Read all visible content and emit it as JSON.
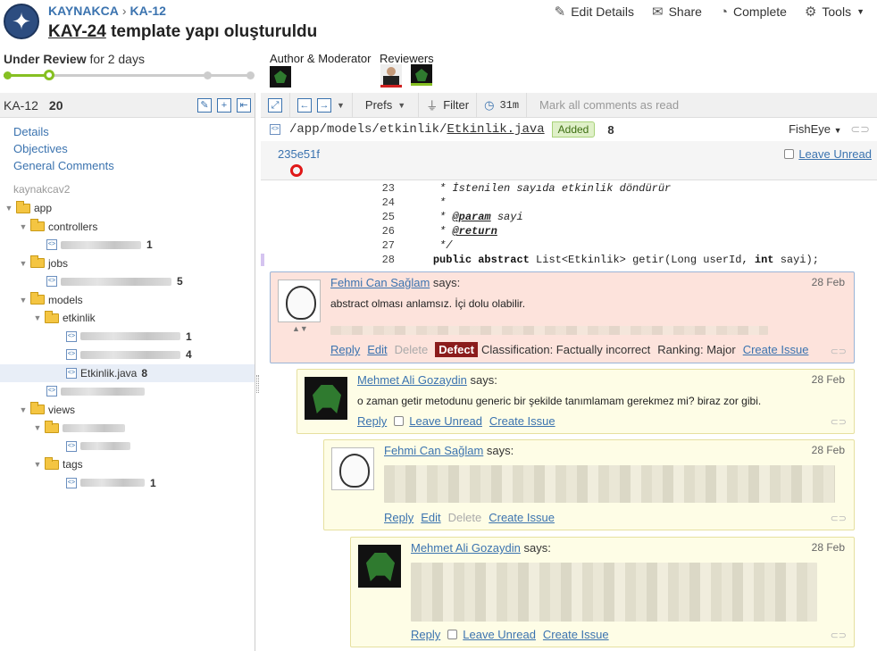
{
  "header": {
    "project": "KAYNAKCA",
    "breadcrumb_sep": "›",
    "review_id": "KA-12",
    "review_key": "KAY-24",
    "review_title": "template yapı oluşturuldu",
    "actions": [
      {
        "label": "Edit Details",
        "icon": "pencil-icon"
      },
      {
        "label": "Share",
        "icon": "envelope-icon"
      },
      {
        "label": "Complete",
        "icon": "check-circle-icon"
      },
      {
        "label": "Tools",
        "icon": "gear-icon"
      }
    ],
    "status_state": "Under Review",
    "status_duration": "for 2 days",
    "progress": 0.19,
    "roles": {
      "author_label": "Author & Moderator",
      "reviewers_label": "Reviewers"
    }
  },
  "left": {
    "review_id": "KA-12",
    "count": "20",
    "links": [
      "Details",
      "Objectives",
      "General Comments"
    ],
    "repo": "kaynakcav2",
    "tree": {
      "app": "app",
      "controllers": "controllers",
      "controllers_file_count": "1",
      "jobs": "jobs",
      "jobs_file_count": "5",
      "models": "models",
      "etkinlik": "etkinlik",
      "etkinlik_f1_count": "1",
      "etkinlik_f2_count": "4",
      "selected_file": "Etkinlik.java",
      "selected_file_count": "8",
      "views": "views",
      "tags": "tags",
      "tags_file_count": "1"
    }
  },
  "right": {
    "toolbar": {
      "prefs": "Prefs",
      "filter": "Filter",
      "timer": "31m",
      "mark_all": "Mark all comments as read"
    },
    "file": {
      "dir": "/app/models/etkinlik/",
      "name": "Etkinlik.java",
      "status": "Added",
      "comment_count": "8",
      "viewer": "FishEye",
      "revision": "235e51f",
      "leave_unread": "Leave Unread"
    },
    "code": [
      {
        "n": "23",
        "t": "     * İstenilen sayıda etkinlik döndürür"
      },
      {
        "n": "24",
        "t": "     *"
      },
      {
        "n": "25",
        "t": "     * @param sayi"
      },
      {
        "n": "26",
        "t": "     * @return"
      },
      {
        "n": "27",
        "t": "     */"
      },
      {
        "n": "28",
        "t": "    public abstract List<Etkinlik> getir(Long userId, int sayi);"
      }
    ],
    "comments": [
      {
        "author": "Fehmi Can Sağlam",
        "says": "says:",
        "date": "28 Feb",
        "text": "abstract olması anlamsız. İçi dolu olabilir.",
        "reply": "Reply",
        "edit": "Edit",
        "delete": "Delete",
        "defect": "Defect",
        "classification": "Classification: Factually incorrect",
        "ranking": "Ranking: Major",
        "create_issue": "Create Issue"
      },
      {
        "author": "Mehmet Ali Gozaydin",
        "says": "says:",
        "date": "28 Feb",
        "text": "o zaman getir metodunu generic bir şekilde tanımlamam gerekmez mi? biraz zor gibi.",
        "reply": "Reply",
        "leave_unread": "Leave Unread",
        "create_issue": "Create Issue"
      },
      {
        "author": "Fehmi Can Sağlam",
        "says": "says:",
        "date": "28 Feb",
        "reply": "Reply",
        "edit": "Edit",
        "delete": "Delete",
        "create_issue": "Create Issue"
      },
      {
        "author": "Mehmet Ali Gozaydin",
        "says": "says:",
        "date": "28 Feb",
        "reply": "Reply",
        "leave_unread": "Leave Unread",
        "create_issue": "Create Issue"
      }
    ]
  },
  "colors": {
    "link": "#3b73af",
    "accent_green": "#86c022",
    "defect": "#8b1c1c",
    "defect_bg": "#fde3dc",
    "comment_bg": "#fefde6"
  }
}
